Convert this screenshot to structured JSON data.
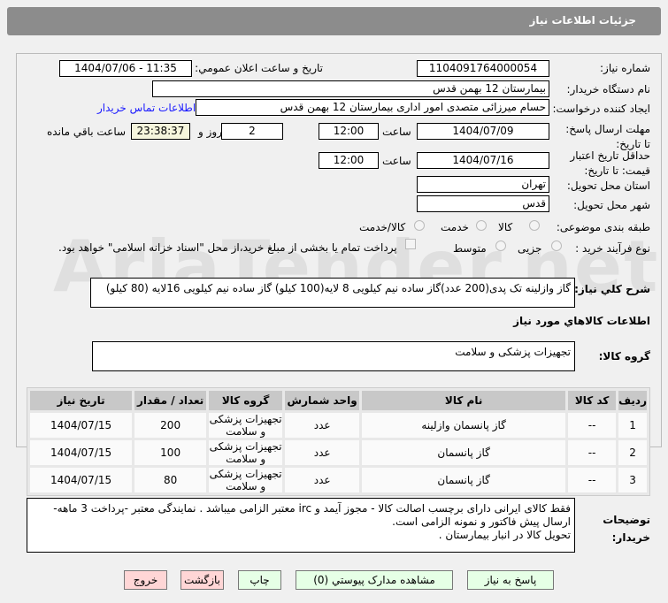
{
  "header": {
    "title": "جزئیات اطلاعات نیاز"
  },
  "form": {
    "need_number_label": "شماره نیاز:",
    "need_number": "1104091764000054",
    "announce_label": "تاريخ و ساعت اعلان عمومي:",
    "announce_value": "1404/07/06 - 11:35",
    "buyer_label": "نام دستگاه خريدار:",
    "buyer": "بیمارستان 12 بهمن قدس",
    "creator_label": "ايجاد کننده درخواست:",
    "creator": "حسام میرزائی متصدی امور اداری بیمارستان 12 بهمن قدس",
    "contact_link": "اطلاعات تماس خريدار",
    "deadline_label": "مهلت ارسال پاسخ: تا تاريخ:",
    "deadline_date": "1404/07/09",
    "time_label": "ساعت",
    "deadline_time": "12:00",
    "days": "2",
    "days_label": "روز و",
    "remaining": "23:38:37",
    "remaining_label": "ساعت باقي مانده",
    "validity_label": "حداقل تاريخ اعتبار قيمت: تا تاريخ:",
    "validity_date": "1404/07/16",
    "validity_time": "12:00",
    "province_label": "استان محل تحويل:",
    "province": "تهران",
    "city_label": "شهر محل تحويل:",
    "city": "قدس",
    "category_label": "طبقه بندی موضوعی:",
    "category_options": [
      "کالا",
      "خدمت",
      "کالا/خدمت"
    ],
    "category_selected": "کالا",
    "purchase_label": "نوع فرآيند خريد :",
    "purchase_options": [
      "جزیی",
      "متوسط"
    ],
    "purchase_selected": "جزیی",
    "payment_note": "پرداخت تمام يا بخشی از مبلغ خريد،از محل \"اسناد خزانه اسلامی\" خواهد بود."
  },
  "description": {
    "label": "شرح کلي نياز:",
    "value": "گاز وازلینه تک پدی(200 عدد)گاز ساده نیم کیلویی 8 لایه(100 کیلو) گاز ساده نیم کیلویی 16لایه (80 کیلو)"
  },
  "goods_header": "اطلاعات کالاهاي مورد نياز",
  "group": {
    "label": "گروه کالا:",
    "value": "تجهیزات پزشکی و سلامت"
  },
  "table": {
    "columns": [
      "رديف",
      "کد کالا",
      "نام کالا",
      "واحد شمارش",
      "گروه کالا",
      "تعداد / مقدار",
      "تاريخ نياز"
    ],
    "rows": [
      [
        "1",
        "--",
        "گاز پانسمان وازلینه",
        "عدد",
        "تجهیزات پزشکی و سلامت",
        "200",
        "1404/07/15"
      ],
      [
        "2",
        "--",
        "گاز پانسمان",
        "عدد",
        "تجهیزات پزشکی و سلامت",
        "100",
        "1404/07/15"
      ],
      [
        "3",
        "--",
        "گاز پانسمان",
        "عدد",
        "تجهیزات پزشکی و سلامت",
        "80",
        "1404/07/15"
      ]
    ]
  },
  "notes": {
    "label": "توضيحات خريدار:",
    "lines": [
      "فقط کالای ایرانی دارای برچسب اصالت کالا - مجوز آیمد و irc معتبر الزامی میباشد . نمایندگی معتبر -پرداخت 3 ماهه- ارسال پیش فاکتور و نمونه الزامی است.",
      "تحویل کالا در انبار بیمارستان ."
    ]
  },
  "buttons": {
    "reply": "پاسخ به نياز",
    "attachments": "مشاهده مدارک پيوستي (0)",
    "print": "چاپ",
    "back": "بازگشت",
    "exit": "خروج"
  },
  "watermark": "AriaTender.net"
}
